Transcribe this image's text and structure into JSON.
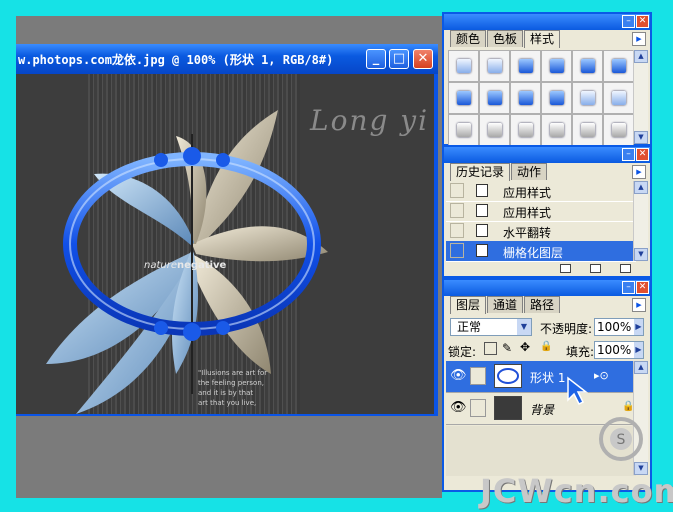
{
  "document": {
    "title": "w.photops.com龙依.jpg @ 100% (形状 1, RGB/8#)",
    "buttons": {
      "minimize": "_",
      "maximize": "□",
      "close": "✕"
    },
    "canvas": {
      "signature": "Long yi",
      "negative_prefix": "nature",
      "negative_word": "negative",
      "quote_lines": [
        "\"Illusions are art for",
        "the feeling person,",
        "and it is by that",
        "art that you live,"
      ]
    }
  },
  "styles_panel": {
    "tabs": [
      "颜色",
      "色板",
      "样式"
    ],
    "active_tab": "样式",
    "swatch_rows": [
      [
        "light",
        "light",
        "dark",
        "dark",
        "dark",
        "dark"
      ],
      [
        "dark",
        "dark",
        "dark",
        "dark",
        "light",
        "light"
      ],
      [
        "grey",
        "grey",
        "grey",
        "grey",
        "grey",
        "grey"
      ]
    ]
  },
  "history_panel": {
    "tabs": [
      "历史记录",
      "动作"
    ],
    "active_tab": "历史记录",
    "items": [
      {
        "label": "应用样式",
        "selected": false
      },
      {
        "label": "应用样式",
        "selected": false
      },
      {
        "label": "水平翻转",
        "selected": false
      },
      {
        "label": "栅格化图层",
        "selected": true
      }
    ]
  },
  "layers_panel": {
    "tabs": [
      "图层",
      "通道",
      "路径"
    ],
    "active_tab": "图层",
    "blend_mode": "正常",
    "opacity_label": "不透明度:",
    "opacity_value": "100%",
    "lock_label": "锁定:",
    "fill_label": "填充:",
    "fill_value": "100%",
    "layers": [
      {
        "name": "形状 1",
        "selected": true,
        "has_effects": true
      },
      {
        "name": "背景",
        "selected": false,
        "locked": true
      }
    ]
  },
  "watermark": "JCWcn.com",
  "colors": {
    "desktop": "#16e2e6",
    "titlebar": "#0a5ae0",
    "selection": "#2f6ee0",
    "panel_bg": "#ece9d8"
  }
}
